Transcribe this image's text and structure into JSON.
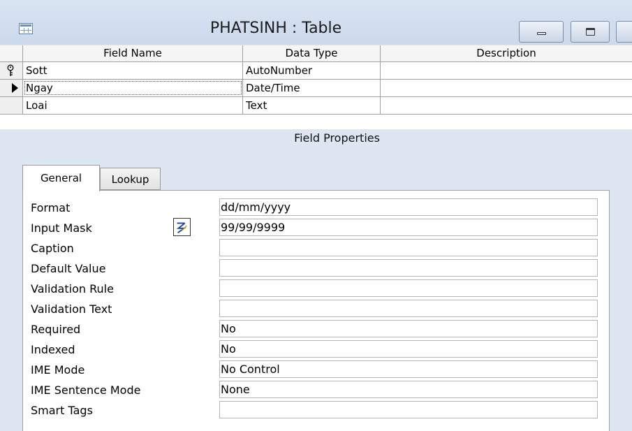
{
  "window": {
    "title": "PHATSINH : Table",
    "icon": "table-icon",
    "controls": [
      "minimize-icon",
      "maximize-icon",
      "close-icon"
    ]
  },
  "grid": {
    "columns": [
      "Field Name",
      "Data Type",
      "Description"
    ],
    "rows": [
      {
        "selector": "primary-key-icon",
        "name": "Sott",
        "type": "AutoNumber",
        "description": ""
      },
      {
        "selector": "current-row-arrow-icon",
        "name": "Ngay",
        "type": "Date/Time",
        "description": ""
      },
      {
        "selector": "",
        "name": "Loai",
        "type": "Text",
        "description": ""
      }
    ]
  },
  "field_properties": {
    "heading": "Field Properties",
    "tabs": [
      "General",
      "Lookup"
    ],
    "active_tab": "General",
    "properties": [
      {
        "label": "Format",
        "value": "dd/mm/yyyy"
      },
      {
        "label": "Input Mask",
        "value": "99/99/9999",
        "builder_icon": "input-mask-wizard-icon"
      },
      {
        "label": "Caption",
        "value": ""
      },
      {
        "label": "Default Value",
        "value": ""
      },
      {
        "label": "Validation Rule",
        "value": ""
      },
      {
        "label": "Validation Text",
        "value": ""
      },
      {
        "label": "Required",
        "value": "No"
      },
      {
        "label": "Indexed",
        "value": "No"
      },
      {
        "label": "IME Mode",
        "value": "No Control"
      },
      {
        "label": "IME Sentence Mode",
        "value": "None"
      },
      {
        "label": "Smart Tags",
        "value": ""
      }
    ]
  }
}
